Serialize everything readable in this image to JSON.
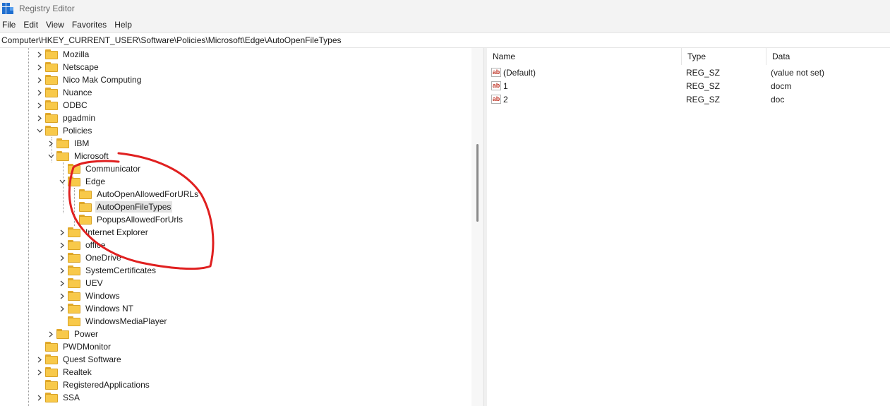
{
  "window": {
    "title": "Registry Editor"
  },
  "menu": [
    {
      "label": "File"
    },
    {
      "label": "Edit"
    },
    {
      "label": "View"
    },
    {
      "label": "Favorites"
    },
    {
      "label": "Help"
    }
  ],
  "address": {
    "path": "Computer\\HKEY_CURRENT_USER\\Software\\Policies\\Microsoft\\Edge\\AutoOpenFileTypes"
  },
  "tree": [
    {
      "label": "Mozilla",
      "depth": 0,
      "state": "collapsed"
    },
    {
      "label": "Netscape",
      "depth": 0,
      "state": "collapsed"
    },
    {
      "label": "Nico Mak Computing",
      "depth": 0,
      "state": "collapsed"
    },
    {
      "label": "Nuance",
      "depth": 0,
      "state": "collapsed"
    },
    {
      "label": "ODBC",
      "depth": 0,
      "state": "collapsed"
    },
    {
      "label": "pgadmin",
      "depth": 0,
      "state": "collapsed"
    },
    {
      "label": "Policies",
      "depth": 0,
      "state": "expanded"
    },
    {
      "label": "IBM",
      "depth": 1,
      "state": "collapsed"
    },
    {
      "label": "Microsoft",
      "depth": 1,
      "state": "expanded"
    },
    {
      "label": "Communicator",
      "depth": 2,
      "state": "leaf"
    },
    {
      "label": "Edge",
      "depth": 2,
      "state": "expanded"
    },
    {
      "label": "AutoOpenAllowedForURLs",
      "depth": 3,
      "state": "leaf"
    },
    {
      "label": "AutoOpenFileTypes",
      "depth": 3,
      "state": "leaf",
      "selected": true
    },
    {
      "label": "PopupsAllowedForUrls",
      "depth": 3,
      "state": "leaf"
    },
    {
      "label": "Internet Explorer",
      "depth": 2,
      "state": "collapsed"
    },
    {
      "label": "office",
      "depth": 2,
      "state": "collapsed"
    },
    {
      "label": "OneDrive",
      "depth": 2,
      "state": "collapsed"
    },
    {
      "label": "SystemCertificates",
      "depth": 2,
      "state": "collapsed"
    },
    {
      "label": "UEV",
      "depth": 2,
      "state": "collapsed"
    },
    {
      "label": "Windows",
      "depth": 2,
      "state": "collapsed"
    },
    {
      "label": "Windows NT",
      "depth": 2,
      "state": "collapsed"
    },
    {
      "label": "WindowsMediaPlayer",
      "depth": 2,
      "state": "leaf"
    },
    {
      "label": "Power",
      "depth": 1,
      "state": "collapsed"
    },
    {
      "label": "PWDMonitor",
      "depth": 0,
      "state": "leaf"
    },
    {
      "label": "Quest Software",
      "depth": 0,
      "state": "collapsed"
    },
    {
      "label": "Realtek",
      "depth": 0,
      "state": "collapsed"
    },
    {
      "label": "RegisteredApplications",
      "depth": 0,
      "state": "leaf"
    },
    {
      "label": "SSA",
      "depth": 0,
      "state": "collapsed"
    }
  ],
  "list": {
    "columns": [
      "Name",
      "Type",
      "Data"
    ],
    "rows": [
      {
        "name": "(Default)",
        "type": "REG_SZ",
        "data": "(value not set)"
      },
      {
        "name": "1",
        "type": "REG_SZ",
        "data": "docm"
      },
      {
        "name": "2",
        "type": "REG_SZ",
        "data": "doc"
      }
    ]
  },
  "icons": {
    "app": "registry-editor-icon",
    "folder": "folder-icon",
    "value": "string-value-icon",
    "value_glyph": "ab",
    "expand": "chevron-right-icon",
    "collapse": "chevron-down-icon"
  },
  "colors": {
    "annotation": "#e02020",
    "folder": "#f8c94a",
    "selection": "#e3e3e3",
    "app_icon": "#1f6fd0"
  }
}
